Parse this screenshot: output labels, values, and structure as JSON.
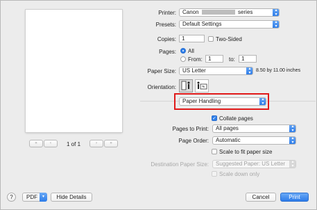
{
  "preview": {
    "page_indicator": "1 of 1",
    "first_glyph": "«",
    "prev_glyph": "‹",
    "next_glyph": "›",
    "last_glyph": "»"
  },
  "printer": {
    "label": "Printer:",
    "value_prefix": "Canon",
    "value_suffix": "series"
  },
  "presets": {
    "label": "Presets:",
    "value": "Default Settings"
  },
  "copies": {
    "label": "Copies:",
    "value": "1",
    "two_sided_label": "Two-Sided",
    "two_sided_checked": false
  },
  "pages": {
    "label": "Pages:",
    "all_label": "All",
    "from_label": "From:",
    "from_value": "1",
    "to_label": "to:",
    "to_value": "1"
  },
  "paper_size": {
    "label": "Paper Size:",
    "value": "US Letter",
    "dimensions": "8.50 by 11.00 inches"
  },
  "orientation": {
    "label": "Orientation:",
    "portrait_icon": "portrait-icon",
    "landscape_icon": "landscape-icon",
    "selected": "portrait"
  },
  "section_popup": {
    "value": "Paper Handling"
  },
  "collate": {
    "label": "Collate pages",
    "checked": true
  },
  "pages_to_print": {
    "label": "Pages to Print:",
    "value": "All pages"
  },
  "page_order": {
    "label": "Page Order:",
    "value": "Automatic"
  },
  "scale_to_fit": {
    "label": "Scale to fit paper size",
    "checked": false
  },
  "destination_paper_size": {
    "label": "Destination Paper Size:",
    "value": "Suggested Paper: US Letter"
  },
  "scale_down_only": {
    "label": "Scale down only",
    "checked": false
  },
  "footer": {
    "help": "?",
    "pdf_label": "PDF",
    "hide_details": "Hide Details",
    "cancel": "Cancel",
    "print": "Print"
  },
  "colors": {
    "accent": "#2f7fe9",
    "highlight_border": "#e01919"
  }
}
